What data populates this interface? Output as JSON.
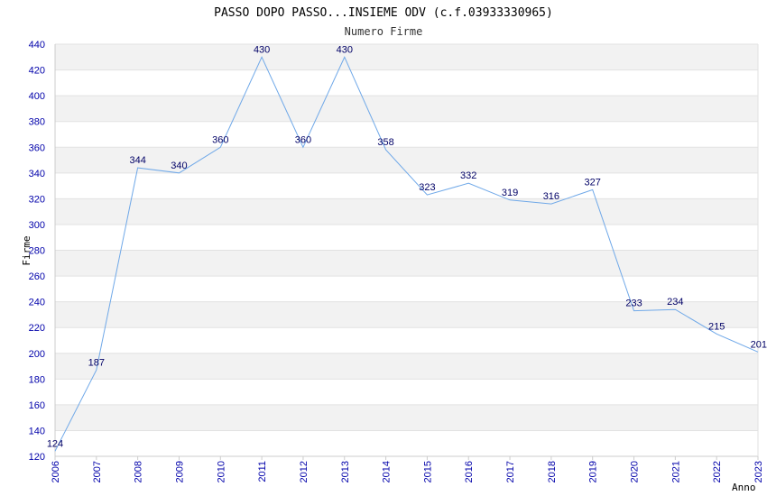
{
  "chart_data": {
    "type": "line",
    "title": "PASSO DOPO PASSO...INSIEME ODV (c.f.03933330965)",
    "subtitle": "Numero Firme",
    "xlabel": "Anno",
    "ylabel": "Firme",
    "x": [
      "2006",
      "2007",
      "2008",
      "2009",
      "2010",
      "2011",
      "2012",
      "2013",
      "2014",
      "2015",
      "2016",
      "2017",
      "2018",
      "2019",
      "2020",
      "2021",
      "2022",
      "2023"
    ],
    "series": [
      {
        "values": [
          124,
          187,
          344,
          340,
          360,
          430,
          360,
          430,
          358,
          323,
          332,
          319,
          316,
          327,
          233,
          234,
          215,
          201
        ]
      }
    ],
    "ylim": [
      120,
      440
    ],
    "yticks": [
      120,
      140,
      160,
      180,
      200,
      220,
      240,
      260,
      280,
      300,
      320,
      340,
      360,
      380,
      400,
      420,
      440
    ],
    "grid": true,
    "line_color": "#6fa8e8",
    "tick_color": "#0000aa",
    "band_color": "#f2f2f2"
  }
}
